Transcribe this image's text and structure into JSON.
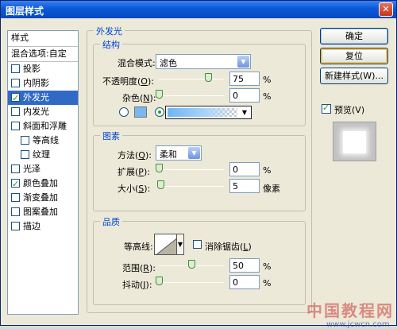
{
  "window": {
    "title": "图层样式",
    "close_glyph": "✕"
  },
  "styles": {
    "header": "样式",
    "blend_options": "混合选项:自定",
    "items": [
      {
        "label": "投影",
        "checked": false,
        "indent": false,
        "selected": false
      },
      {
        "label": "内阴影",
        "checked": false,
        "indent": false,
        "selected": false
      },
      {
        "label": "外发光",
        "checked": true,
        "indent": false,
        "selected": true
      },
      {
        "label": "内发光",
        "checked": false,
        "indent": false,
        "selected": false
      },
      {
        "label": "斜面和浮雕",
        "checked": false,
        "indent": false,
        "selected": false
      },
      {
        "label": "等高线",
        "checked": false,
        "indent": true,
        "selected": false
      },
      {
        "label": "纹理",
        "checked": false,
        "indent": true,
        "selected": false
      },
      {
        "label": "光泽",
        "checked": false,
        "indent": false,
        "selected": false
      },
      {
        "label": "颜色叠加",
        "checked": true,
        "indent": false,
        "selected": false
      },
      {
        "label": "渐变叠加",
        "checked": false,
        "indent": false,
        "selected": false
      },
      {
        "label": "图案叠加",
        "checked": false,
        "indent": false,
        "selected": false
      },
      {
        "label": "描边",
        "checked": false,
        "indent": false,
        "selected": false
      }
    ]
  },
  "outer_glow": {
    "title": "外发光",
    "structure": {
      "title": "结构",
      "blend_mode_label": "混合模式",
      "blend_mode_value": "滤色",
      "opacity_label": "不透明度",
      "opacity_accel": "O",
      "opacity_value": "75",
      "opacity_level": 75,
      "noise_label": "杂色",
      "noise_accel": "N",
      "noise_value": "0",
      "noise_level": 0,
      "percent": "%",
      "color_swatch": "#79b7f0"
    },
    "elements": {
      "title": "图素",
      "technique_label": "方法",
      "technique_accel": "Q",
      "technique_value": "柔和",
      "spread_label": "扩展",
      "spread_accel": "P",
      "spread_value": "0",
      "spread_level": 0,
      "size_label": "大小",
      "size_accel": "S",
      "size_value": "5",
      "size_level": 2.0,
      "percent": "%",
      "pixels": "像素"
    },
    "quality": {
      "title": "品质",
      "contour_label": "等高线",
      "antialias_label": "消除锯齿",
      "antialias_accel": "L",
      "range_label": "范围",
      "range_accel": "R",
      "range_value": "50",
      "range_level": 50,
      "jitter_label": "抖动",
      "jitter_accel": "J",
      "jitter_value": "0",
      "jitter_level": 0,
      "percent": "%"
    }
  },
  "buttons": {
    "ok": "确定",
    "reset": "复位",
    "new_style": "新建样式(W)...",
    "preview": "预览(V)"
  },
  "watermark": {
    "text": "中国教程网",
    "url": "www.jcwcn.com"
  }
}
